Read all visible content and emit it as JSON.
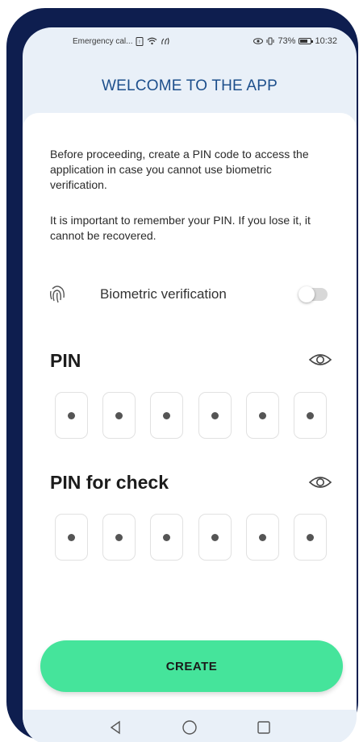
{
  "status_bar": {
    "carrier": "Emergency cal...",
    "battery_percent": "73%",
    "time": "10:32"
  },
  "header": {
    "title": "WELCOME TO THE APP"
  },
  "intro": {
    "paragraph_1": "Before proceeding, create a PIN code to access the application in case you cannot use biometric verification.",
    "paragraph_2": "It is important to remember your PIN. If you lose it, it cannot be recovered."
  },
  "biometric": {
    "label": "Biometric verification",
    "enabled": false,
    "icon": "fingerprint-icon"
  },
  "pin": {
    "label": "PIN",
    "length": 6,
    "masked_char": "•"
  },
  "pin_check": {
    "label": "PIN for check",
    "length": 6,
    "masked_char": "•"
  },
  "actions": {
    "create_label": "CREATE"
  },
  "colors": {
    "frame": "#0e1e4f",
    "title": "#1d4f8c",
    "create_button": "#45e49b",
    "screen_bg": "#e9f0f8"
  }
}
